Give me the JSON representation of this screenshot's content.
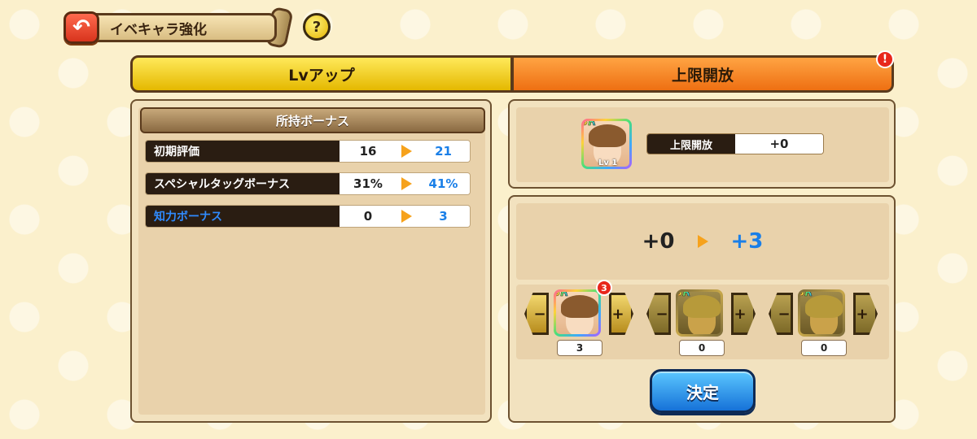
{
  "header": {
    "title": "イベキャラ強化",
    "back_icon": "back-arrow-icon",
    "help_label": "?"
  },
  "tabs": [
    {
      "label": "Lvアップ",
      "active": true
    },
    {
      "label": "上限開放",
      "active": false,
      "alert": "!"
    }
  ],
  "bonus_panel": {
    "header": "所持ボーナス",
    "rows": [
      {
        "label": "初期評価",
        "from": "16",
        "to": "21",
        "label_color": "white"
      },
      {
        "label": "スペシャルタッグボーナス",
        "from": "31%",
        "to": "41%",
        "label_color": "white"
      },
      {
        "label": "知力ボーナス",
        "from": "0",
        "to": "3",
        "label_color": "blue"
      }
    ]
  },
  "character": {
    "rarity": "SR",
    "level_label": "Lv 1"
  },
  "limit": {
    "label": "上限開放",
    "value": "+0"
  },
  "change": {
    "from": "+0",
    "to": "+3"
  },
  "materials": [
    {
      "rarity": "SR",
      "badge": "3",
      "count": "3"
    },
    {
      "rarity": "SR",
      "count": "0"
    },
    {
      "rarity": "SR",
      "count": "0"
    }
  ],
  "stepper": {
    "minus": "−",
    "plus": "+"
  },
  "confirm_label": "決定",
  "colors": {
    "accent_blue": "#1a7fe8",
    "tab_yellow": "#e4b800",
    "tab_orange": "#ee6f12",
    "arrow": "#f6a21c"
  }
}
